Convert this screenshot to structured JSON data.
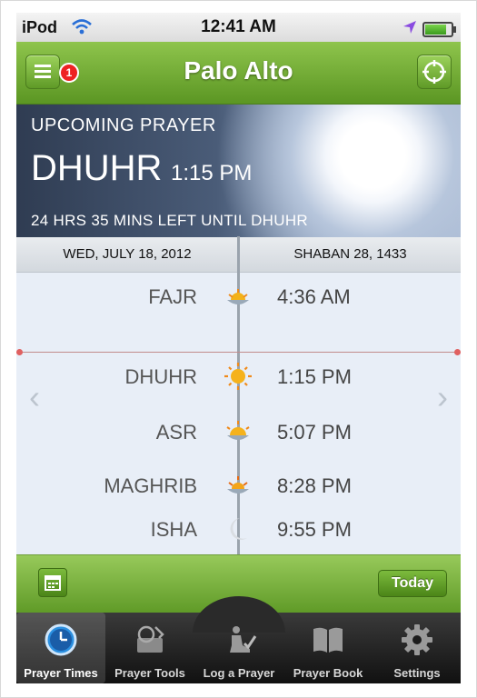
{
  "status_bar": {
    "carrier": "iPod",
    "time": "12:41 AM",
    "icons": [
      "wifi-icon",
      "location-arrow-icon",
      "battery-icon"
    ]
  },
  "header": {
    "title": "Palo Alto",
    "menu_badge": "1",
    "icons": [
      "menu-icon",
      "locate-icon"
    ]
  },
  "upcoming": {
    "label": "UPCOMING PRAYER",
    "prayer": "DHUHR",
    "time": "1:15 PM",
    "countdown": "24 HRS 35 MINS LEFT UNTIL DHUHR"
  },
  "dates": {
    "gregorian": "WED, JULY 18, 2012",
    "hijri": "SHABAN 28, 1433"
  },
  "prayers": [
    {
      "name": "FAJR",
      "time": "4:36 AM",
      "icon": "sunrise-icon"
    },
    {
      "name": "DHUHR",
      "time": "1:15 PM",
      "icon": "sun-icon"
    },
    {
      "name": "ASR",
      "time": "5:07 PM",
      "icon": "half-sun-icon"
    },
    {
      "name": "MAGHRIB",
      "time": "8:28 PM",
      "icon": "sunset-icon"
    },
    {
      "name": "ISHA",
      "time": "9:55 PM",
      "icon": "moon-icon"
    }
  ],
  "controls": {
    "today_label": "Today",
    "icons": [
      "calendar-icon",
      "chevron-left-icon",
      "chevron-right-icon"
    ]
  },
  "tabs": [
    {
      "label": "Prayer Times",
      "icon": "clock-icon",
      "active": true
    },
    {
      "label": "Prayer Tools",
      "icon": "tools-icon",
      "active": false
    },
    {
      "label": "Log a Prayer",
      "icon": "prayer-icon",
      "active": false
    },
    {
      "label": "Prayer Book",
      "icon": "book-icon",
      "active": false
    },
    {
      "label": "Settings",
      "icon": "gear-icon",
      "active": false
    }
  ],
  "colors": {
    "accent_green": "#6aa92f",
    "tabbar": "#1c1c1c",
    "schedule_bg": "#e8eef7"
  }
}
